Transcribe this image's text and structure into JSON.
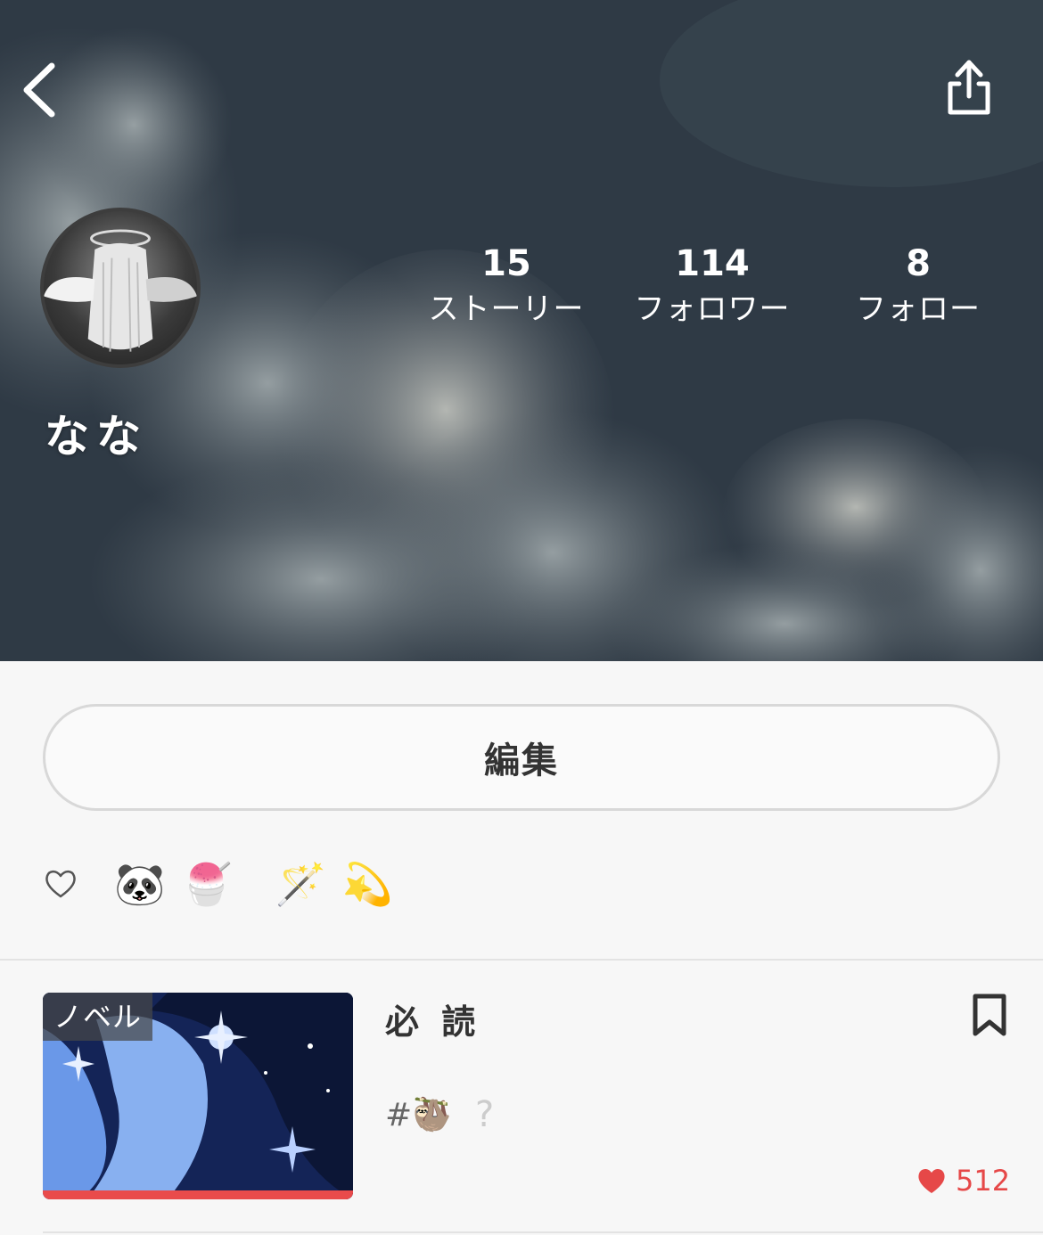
{
  "profile": {
    "name": "なな",
    "stats": [
      {
        "value": "15",
        "label": "ストーリー"
      },
      {
        "value": "114",
        "label": "フォロワー"
      },
      {
        "value": "8",
        "label": "フォロー"
      }
    ]
  },
  "actions": {
    "edit_label": "編集"
  },
  "bio": {
    "icon": "heart-outline-icon",
    "emojis": [
      "🐼",
      "🍧",
      "🪄",
      "💫"
    ]
  },
  "story": {
    "badge": "ノベル",
    "title": "必 読",
    "tag_prefix": "#",
    "tag_emoji": "🦥",
    "tag_extra": "?",
    "likes": "512"
  },
  "colors": {
    "accent_red": "#e64848",
    "progress_red": "#e94b4b",
    "cover_dark": "#2c3641"
  }
}
